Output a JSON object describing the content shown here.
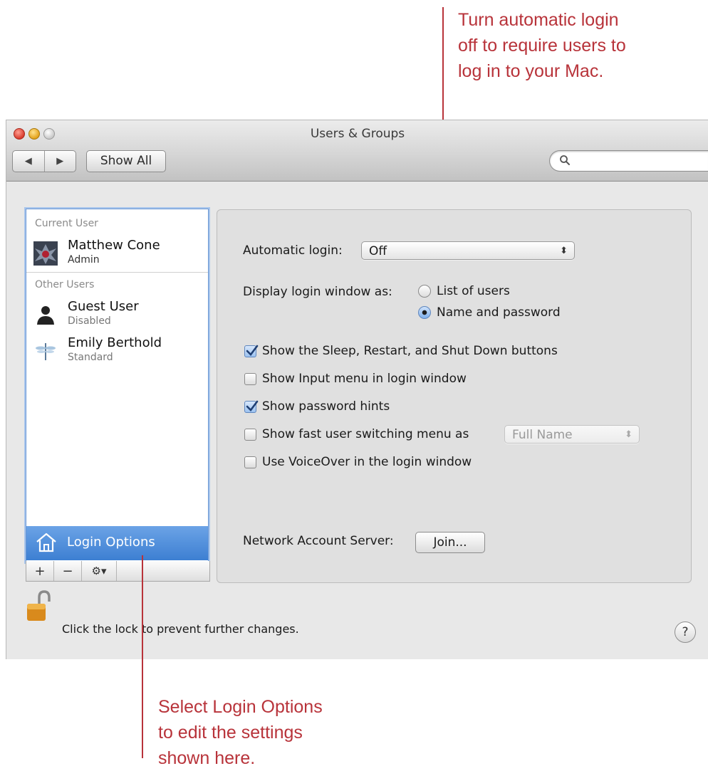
{
  "annotations": {
    "top": [
      "Turn automatic login",
      "off to require users to",
      "log in to your Mac."
    ],
    "bottom": [
      "Select Login Options",
      "to edit the settings",
      "shown here."
    ],
    "color": "#b8333a"
  },
  "window": {
    "title": "Users & Groups",
    "toolbar": {
      "back_icon": "◀",
      "forward_icon": "▶",
      "show_all_label": "Show All",
      "search_placeholder": ""
    }
  },
  "sidebar": {
    "current_user_header": "Current User",
    "current_user": {
      "name": "Matthew Cone",
      "role": "Admin"
    },
    "other_users_header": "Other Users",
    "other_users": [
      {
        "name": "Guest User",
        "role": "Disabled"
      },
      {
        "name": "Emily Berthold",
        "role": "Standard"
      }
    ],
    "selected_item": "Login Options",
    "toolbar": {
      "add": "+",
      "remove": "−",
      "action": "⚙▾"
    }
  },
  "login_options": {
    "automatic_login_label": "Automatic login:",
    "automatic_login_value": "Off",
    "display_window_label": "Display login window as:",
    "radio_list_of_users": "List of users",
    "radio_name_and_password": "Name and password",
    "selected_display": "Name and password",
    "checkboxes": [
      {
        "label": "Show the Sleep, Restart, and Shut Down buttons",
        "checked": true
      },
      {
        "label": "Show Input menu in login window",
        "checked": false
      },
      {
        "label": "Show password hints",
        "checked": true
      },
      {
        "label": "Show fast user switching menu as",
        "checked": false
      },
      {
        "label": "Use VoiceOver in the login window",
        "checked": false
      }
    ],
    "fast_user_switching_value": "Full Name",
    "network_account_label": "Network Account Server:",
    "join_button": "Join..."
  },
  "footer": {
    "lock_text": "Click the lock to prevent further changes.",
    "help_label": "?"
  }
}
